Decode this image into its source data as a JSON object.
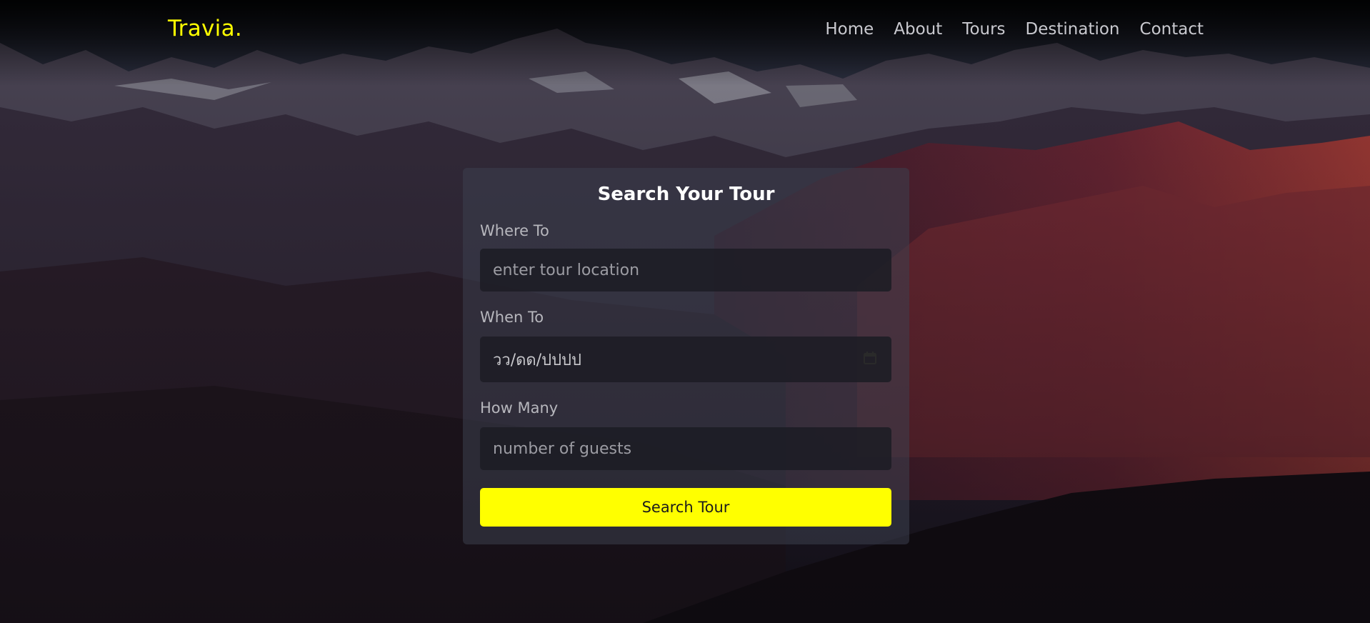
{
  "brand": {
    "logo": "Travia."
  },
  "nav": {
    "items": [
      {
        "label": "Home"
      },
      {
        "label": "About"
      },
      {
        "label": "Tours"
      },
      {
        "label": "Destination"
      },
      {
        "label": "Contact"
      }
    ]
  },
  "search_form": {
    "title": "Search Your Tour",
    "where": {
      "label": "Where To",
      "placeholder": "enter tour location",
      "value": ""
    },
    "when": {
      "label": "When To",
      "placeholder": "วว/ดด/ปปปป",
      "value": "",
      "icon": "calendar-icon"
    },
    "guests": {
      "label": "How Many",
      "placeholder": "number of guests",
      "value": ""
    },
    "submit_label": "Search Tour"
  },
  "colors": {
    "accent": "#ffff00",
    "panel_bg": "rgba(60,64,78,0.55)",
    "field_bg": "#1c1c24",
    "nav_text": "#c9c9cf"
  }
}
